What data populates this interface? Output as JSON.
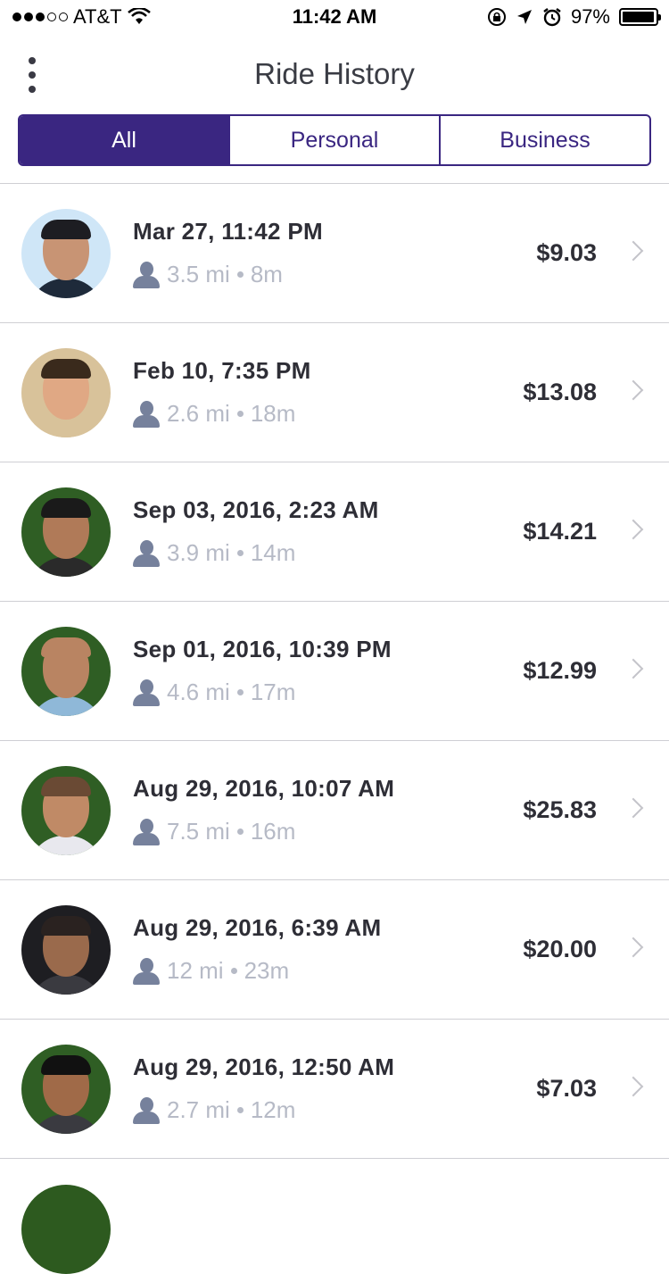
{
  "status_bar": {
    "carrier": "AT&T",
    "time": "11:42 AM",
    "battery": "97%",
    "battery_level": 0.97,
    "signal_bars_filled": 3,
    "signal_bars_total": 5
  },
  "header": {
    "title": "Ride History"
  },
  "tabs": [
    {
      "label": "All",
      "active": true
    },
    {
      "label": "Personal",
      "active": false
    },
    {
      "label": "Business",
      "active": false
    }
  ],
  "colors": {
    "accent": "#3a2681",
    "meta_text": "#b6bac6",
    "icon": "#76819c"
  },
  "rides": [
    {
      "date": "Mar 27, 11:42 PM",
      "distance": "3.5 mi",
      "duration": "8m",
      "price": "$9.03",
      "avatar": "driver-avatar-1"
    },
    {
      "date": "Feb 10, 7:35 PM",
      "distance": "2.6 mi",
      "duration": "18m",
      "price": "$13.08",
      "avatar": "driver-avatar-2"
    },
    {
      "date": "Sep 03, 2016, 2:23 AM",
      "distance": "3.9 mi",
      "duration": "14m",
      "price": "$14.21",
      "avatar": "driver-avatar-3"
    },
    {
      "date": "Sep 01, 2016, 10:39 PM",
      "distance": "4.6 mi",
      "duration": "17m",
      "price": "$12.99",
      "avatar": "driver-avatar-4"
    },
    {
      "date": "Aug 29, 2016, 10:07 AM",
      "distance": "7.5 mi",
      "duration": "16m",
      "price": "$25.83",
      "avatar": "driver-avatar-5"
    },
    {
      "date": "Aug 29, 2016, 6:39 AM",
      "distance": "12 mi",
      "duration": "23m",
      "price": "$20.00",
      "avatar": "driver-avatar-6"
    },
    {
      "date": "Aug 29, 2016, 12:50 AM",
      "distance": "2.7 mi",
      "duration": "12m",
      "price": "$7.03",
      "avatar": "driver-avatar-7"
    }
  ]
}
